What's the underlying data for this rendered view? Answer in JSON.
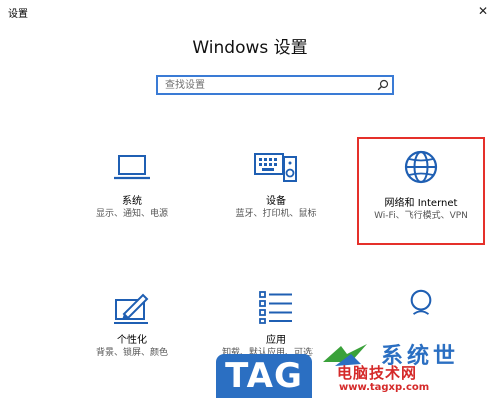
{
  "window": {
    "title": "设置",
    "close_glyph": "✕"
  },
  "page_title": "Windows 设置",
  "search": {
    "placeholder": "查找设置",
    "value": ""
  },
  "colors": {
    "accent": "#3a7bd5",
    "highlight_border": "#e5302a",
    "icon": "#1f5fb3"
  },
  "tiles": [
    {
      "icon": "laptop-icon",
      "name": "系统",
      "desc": "显示、通知、电源"
    },
    {
      "icon": "devices-icon",
      "name": "设备",
      "desc": "蓝牙、打印机、鼠标"
    },
    {
      "icon": "globe-icon",
      "name": "网络和 Internet",
      "desc": "Wi-Fi、飞行模式、VPN"
    },
    {
      "icon": "personalization-icon",
      "name": "个性化",
      "desc": "背景、锁屏、颜色"
    },
    {
      "icon": "apps-icon",
      "name": "应用",
      "desc": "卸载、默认应用、可选功能"
    },
    {
      "icon": "account-icon",
      "name": "",
      "desc": ""
    }
  ],
  "watermark": {
    "tag": "TAG",
    "brand": "系统世",
    "site": "电脑技术网",
    "url": "www.tagxp.com"
  }
}
